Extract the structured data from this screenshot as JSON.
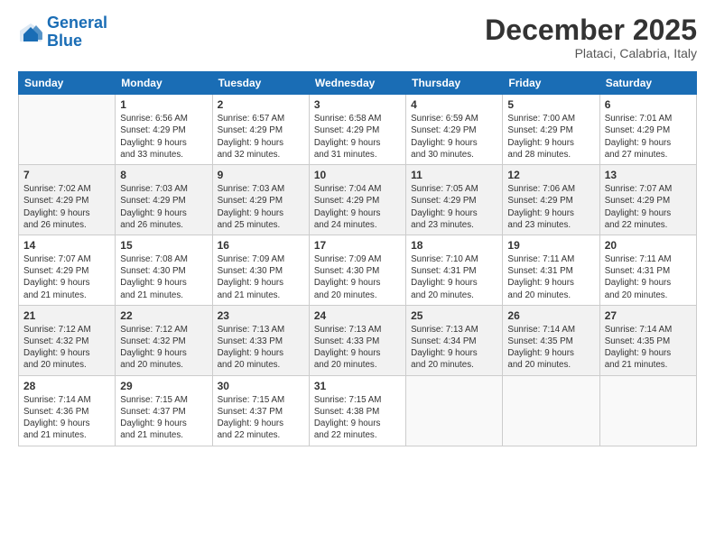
{
  "header": {
    "logo_line1": "General",
    "logo_line2": "Blue",
    "month": "December 2025",
    "location": "Plataci, Calabria, Italy"
  },
  "days_of_week": [
    "Sunday",
    "Monday",
    "Tuesday",
    "Wednesday",
    "Thursday",
    "Friday",
    "Saturday"
  ],
  "weeks": [
    [
      {
        "day": "",
        "info": ""
      },
      {
        "day": "1",
        "info": "Sunrise: 6:56 AM\nSunset: 4:29 PM\nDaylight: 9 hours\nand 33 minutes."
      },
      {
        "day": "2",
        "info": "Sunrise: 6:57 AM\nSunset: 4:29 PM\nDaylight: 9 hours\nand 32 minutes."
      },
      {
        "day": "3",
        "info": "Sunrise: 6:58 AM\nSunset: 4:29 PM\nDaylight: 9 hours\nand 31 minutes."
      },
      {
        "day": "4",
        "info": "Sunrise: 6:59 AM\nSunset: 4:29 PM\nDaylight: 9 hours\nand 30 minutes."
      },
      {
        "day": "5",
        "info": "Sunrise: 7:00 AM\nSunset: 4:29 PM\nDaylight: 9 hours\nand 28 minutes."
      },
      {
        "day": "6",
        "info": "Sunrise: 7:01 AM\nSunset: 4:29 PM\nDaylight: 9 hours\nand 27 minutes."
      }
    ],
    [
      {
        "day": "7",
        "info": "Sunrise: 7:02 AM\nSunset: 4:29 PM\nDaylight: 9 hours\nand 26 minutes."
      },
      {
        "day": "8",
        "info": "Sunrise: 7:03 AM\nSunset: 4:29 PM\nDaylight: 9 hours\nand 26 minutes."
      },
      {
        "day": "9",
        "info": "Sunrise: 7:03 AM\nSunset: 4:29 PM\nDaylight: 9 hours\nand 25 minutes."
      },
      {
        "day": "10",
        "info": "Sunrise: 7:04 AM\nSunset: 4:29 PM\nDaylight: 9 hours\nand 24 minutes."
      },
      {
        "day": "11",
        "info": "Sunrise: 7:05 AM\nSunset: 4:29 PM\nDaylight: 9 hours\nand 23 minutes."
      },
      {
        "day": "12",
        "info": "Sunrise: 7:06 AM\nSunset: 4:29 PM\nDaylight: 9 hours\nand 23 minutes."
      },
      {
        "day": "13",
        "info": "Sunrise: 7:07 AM\nSunset: 4:29 PM\nDaylight: 9 hours\nand 22 minutes."
      }
    ],
    [
      {
        "day": "14",
        "info": "Sunrise: 7:07 AM\nSunset: 4:29 PM\nDaylight: 9 hours\nand 21 minutes."
      },
      {
        "day": "15",
        "info": "Sunrise: 7:08 AM\nSunset: 4:30 PM\nDaylight: 9 hours\nand 21 minutes."
      },
      {
        "day": "16",
        "info": "Sunrise: 7:09 AM\nSunset: 4:30 PM\nDaylight: 9 hours\nand 21 minutes."
      },
      {
        "day": "17",
        "info": "Sunrise: 7:09 AM\nSunset: 4:30 PM\nDaylight: 9 hours\nand 20 minutes."
      },
      {
        "day": "18",
        "info": "Sunrise: 7:10 AM\nSunset: 4:31 PM\nDaylight: 9 hours\nand 20 minutes."
      },
      {
        "day": "19",
        "info": "Sunrise: 7:11 AM\nSunset: 4:31 PM\nDaylight: 9 hours\nand 20 minutes."
      },
      {
        "day": "20",
        "info": "Sunrise: 7:11 AM\nSunset: 4:31 PM\nDaylight: 9 hours\nand 20 minutes."
      }
    ],
    [
      {
        "day": "21",
        "info": "Sunrise: 7:12 AM\nSunset: 4:32 PM\nDaylight: 9 hours\nand 20 minutes."
      },
      {
        "day": "22",
        "info": "Sunrise: 7:12 AM\nSunset: 4:32 PM\nDaylight: 9 hours\nand 20 minutes."
      },
      {
        "day": "23",
        "info": "Sunrise: 7:13 AM\nSunset: 4:33 PM\nDaylight: 9 hours\nand 20 minutes."
      },
      {
        "day": "24",
        "info": "Sunrise: 7:13 AM\nSunset: 4:33 PM\nDaylight: 9 hours\nand 20 minutes."
      },
      {
        "day": "25",
        "info": "Sunrise: 7:13 AM\nSunset: 4:34 PM\nDaylight: 9 hours\nand 20 minutes."
      },
      {
        "day": "26",
        "info": "Sunrise: 7:14 AM\nSunset: 4:35 PM\nDaylight: 9 hours\nand 20 minutes."
      },
      {
        "day": "27",
        "info": "Sunrise: 7:14 AM\nSunset: 4:35 PM\nDaylight: 9 hours\nand 21 minutes."
      }
    ],
    [
      {
        "day": "28",
        "info": "Sunrise: 7:14 AM\nSunset: 4:36 PM\nDaylight: 9 hours\nand 21 minutes."
      },
      {
        "day": "29",
        "info": "Sunrise: 7:15 AM\nSunset: 4:37 PM\nDaylight: 9 hours\nand 21 minutes."
      },
      {
        "day": "30",
        "info": "Sunrise: 7:15 AM\nSunset: 4:37 PM\nDaylight: 9 hours\nand 22 minutes."
      },
      {
        "day": "31",
        "info": "Sunrise: 7:15 AM\nSunset: 4:38 PM\nDaylight: 9 hours\nand 22 minutes."
      },
      {
        "day": "",
        "info": ""
      },
      {
        "day": "",
        "info": ""
      },
      {
        "day": "",
        "info": ""
      }
    ]
  ]
}
